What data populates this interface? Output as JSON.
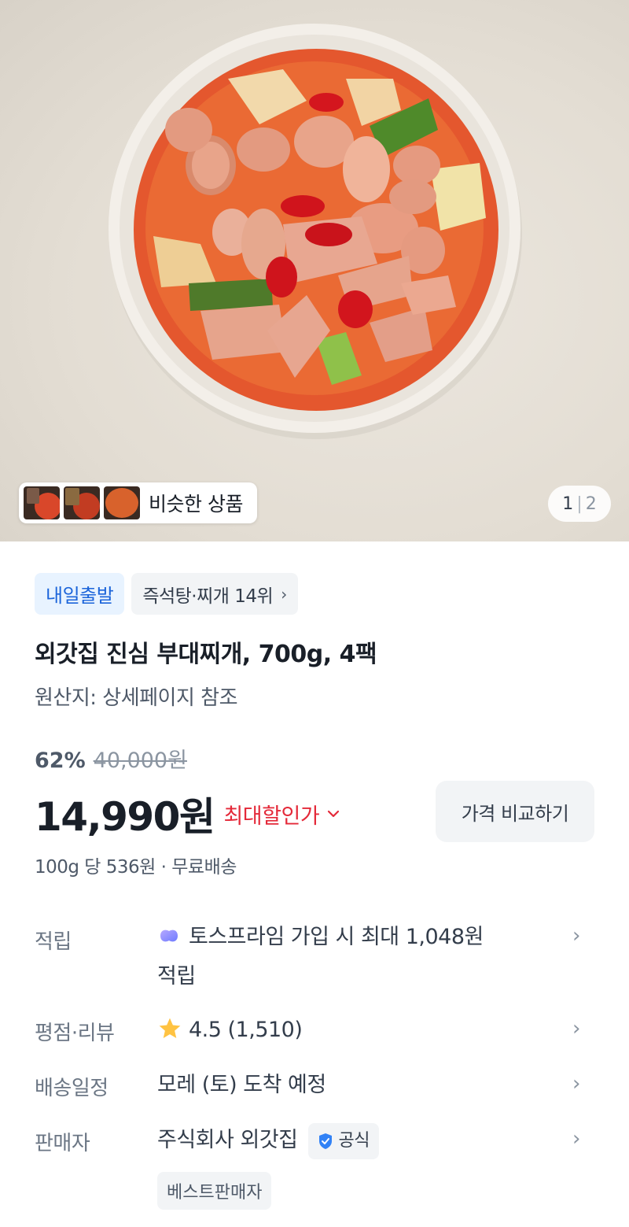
{
  "hero": {
    "similar_label": "비슷한 상품",
    "page_current": "1",
    "page_total": "2"
  },
  "tags": {
    "shipping": "내일출발",
    "rank": "즉석탕·찌개 14위"
  },
  "product": {
    "title": "외갓집 진심 부대찌개, 700g, 4팩",
    "origin": "원산지: 상세페이지 참조"
  },
  "pricing": {
    "discount_pct": "62%",
    "original_price": "40,000원",
    "price": "14,990원",
    "max_deal_label": "최대할인가",
    "compare_button": "가격 비교하기",
    "unit_info": "100g 당 536원 · 무료배송"
  },
  "info": {
    "points_label": "적립",
    "points_line1": "토스프라임 가입 시 최대 1,048원",
    "points_line2": "적립",
    "rating_label": "평점·리뷰",
    "rating_value": "4.5 (1,510)",
    "delivery_label": "배송일정",
    "delivery_value": "모레 (토) 도착 예정",
    "seller_label": "판매자",
    "seller_name": "주식회사 외갓집",
    "official_badge": "공식",
    "best_seller_badge": "베스트판매자"
  },
  "colors": {
    "accent_blue": "#1b64da",
    "deal_red": "#e42939",
    "star_yellow": "#ffc342"
  },
  "icons": [
    "chevron-right-icon",
    "chevron-down-icon",
    "star-icon",
    "toss-prime-icon",
    "verified-shield-icon"
  ]
}
